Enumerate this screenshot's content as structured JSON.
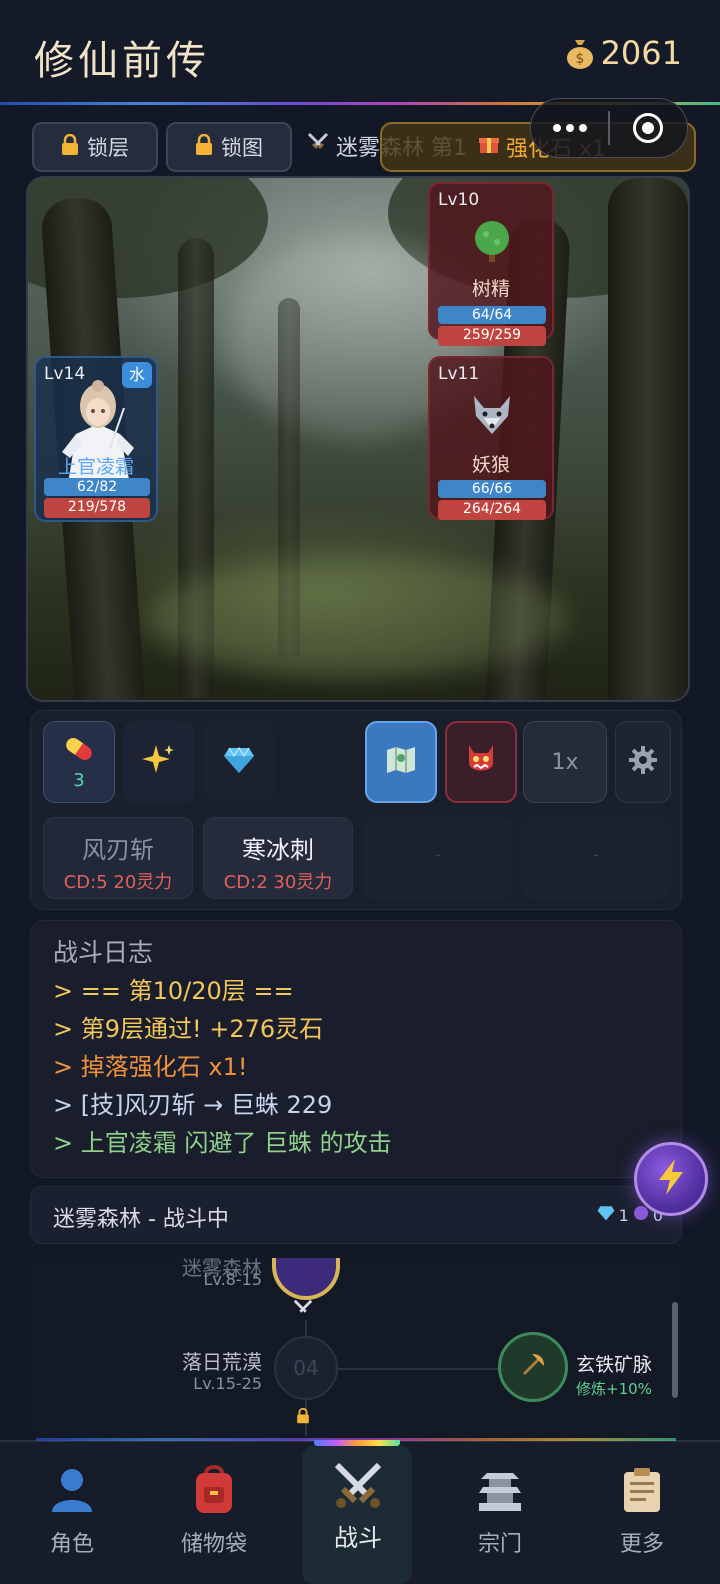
{
  "header": {
    "title": "修仙前传",
    "coins": "2061",
    "coin_icon": "money-bag-icon"
  },
  "toolbar": {
    "lock_floor_label": "锁层",
    "lock_map_label": "锁图",
    "region_text": "迷雾森林 第1",
    "drop_badge": "强化石 x1"
  },
  "enemies": [
    {
      "level": "Lv10",
      "name": "树精",
      "mp": "64/64",
      "hp": "259/259",
      "icon": "tree-icon"
    },
    {
      "level": "Lv11",
      "name": "妖狼",
      "mp": "66/66",
      "hp": "264/264",
      "icon": "wolf-icon"
    }
  ],
  "hero": {
    "level": "Lv14",
    "element": "水",
    "name": "上官凌霜",
    "mp": "62/82",
    "hp": "219/578"
  },
  "actions": {
    "pill_count": "3",
    "speed_label": "1x",
    "skills": [
      {
        "name": "风刃斩",
        "cost": "CD:5  20灵力"
      },
      {
        "name": "寒冰刺",
        "cost": "CD:2  30灵力"
      },
      {
        "name": "-"
      },
      {
        "name": "-"
      }
    ]
  },
  "log": {
    "title": "战斗日志",
    "lines": [
      "> == 第10/20层 ==",
      "> 第9层通过! +276灵石",
      "> 掉落强化石 x1!",
      "> [技]风刃斩 → 巨蛛 229",
      "> 上官凌霜 闪避了 巨蛛 的攻击"
    ]
  },
  "status": {
    "text": "迷雾森林 - 战斗中",
    "gems": "1",
    "orbs": "0"
  },
  "map": {
    "current_name": "迷雾森林",
    "current_levels": "Lv.8-15",
    "next_name": "落日荒漠",
    "next_levels": "Lv.15-25",
    "next_index": "04",
    "side_name": "玄铁矿脉",
    "side_bonus": "修炼+10%"
  },
  "nav": [
    {
      "label": "角色",
      "icon": "character-icon"
    },
    {
      "label": "储物袋",
      "icon": "backpack-icon"
    },
    {
      "label": "战斗",
      "icon": "crossed-swords-icon"
    },
    {
      "label": "宗门",
      "icon": "pagoda-icon"
    },
    {
      "label": "更多",
      "icon": "clipboard-icon"
    }
  ],
  "colors": {
    "accent_gold": "#f0a838",
    "hp_red": "#c0443f",
    "mp_blue": "#3f86c8",
    "log_yellow": "#f2c75a",
    "log_orange": "#f0923c",
    "log_green": "#8fd08a"
  }
}
